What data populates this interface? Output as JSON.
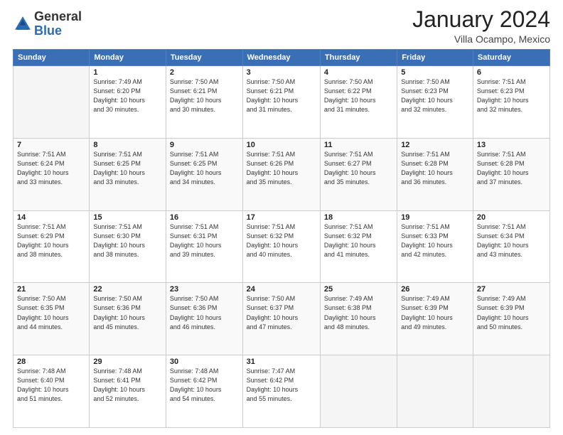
{
  "logo": {
    "general": "General",
    "blue": "Blue"
  },
  "title": "January 2024",
  "location": "Villa Ocampo, Mexico",
  "days_header": [
    "Sunday",
    "Monday",
    "Tuesday",
    "Wednesday",
    "Thursday",
    "Friday",
    "Saturday"
  ],
  "weeks": [
    [
      {
        "day": "",
        "info": ""
      },
      {
        "day": "1",
        "info": "Sunrise: 7:49 AM\nSunset: 6:20 PM\nDaylight: 10 hours\nand 30 minutes."
      },
      {
        "day": "2",
        "info": "Sunrise: 7:50 AM\nSunset: 6:21 PM\nDaylight: 10 hours\nand 30 minutes."
      },
      {
        "day": "3",
        "info": "Sunrise: 7:50 AM\nSunset: 6:21 PM\nDaylight: 10 hours\nand 31 minutes."
      },
      {
        "day": "4",
        "info": "Sunrise: 7:50 AM\nSunset: 6:22 PM\nDaylight: 10 hours\nand 31 minutes."
      },
      {
        "day": "5",
        "info": "Sunrise: 7:50 AM\nSunset: 6:23 PM\nDaylight: 10 hours\nand 32 minutes."
      },
      {
        "day": "6",
        "info": "Sunrise: 7:51 AM\nSunset: 6:23 PM\nDaylight: 10 hours\nand 32 minutes."
      }
    ],
    [
      {
        "day": "7",
        "info": "Sunrise: 7:51 AM\nSunset: 6:24 PM\nDaylight: 10 hours\nand 33 minutes."
      },
      {
        "day": "8",
        "info": "Sunrise: 7:51 AM\nSunset: 6:25 PM\nDaylight: 10 hours\nand 33 minutes."
      },
      {
        "day": "9",
        "info": "Sunrise: 7:51 AM\nSunset: 6:25 PM\nDaylight: 10 hours\nand 34 minutes."
      },
      {
        "day": "10",
        "info": "Sunrise: 7:51 AM\nSunset: 6:26 PM\nDaylight: 10 hours\nand 35 minutes."
      },
      {
        "day": "11",
        "info": "Sunrise: 7:51 AM\nSunset: 6:27 PM\nDaylight: 10 hours\nand 35 minutes."
      },
      {
        "day": "12",
        "info": "Sunrise: 7:51 AM\nSunset: 6:28 PM\nDaylight: 10 hours\nand 36 minutes."
      },
      {
        "day": "13",
        "info": "Sunrise: 7:51 AM\nSunset: 6:28 PM\nDaylight: 10 hours\nand 37 minutes."
      }
    ],
    [
      {
        "day": "14",
        "info": "Sunrise: 7:51 AM\nSunset: 6:29 PM\nDaylight: 10 hours\nand 38 minutes."
      },
      {
        "day": "15",
        "info": "Sunrise: 7:51 AM\nSunset: 6:30 PM\nDaylight: 10 hours\nand 38 minutes."
      },
      {
        "day": "16",
        "info": "Sunrise: 7:51 AM\nSunset: 6:31 PM\nDaylight: 10 hours\nand 39 minutes."
      },
      {
        "day": "17",
        "info": "Sunrise: 7:51 AM\nSunset: 6:32 PM\nDaylight: 10 hours\nand 40 minutes."
      },
      {
        "day": "18",
        "info": "Sunrise: 7:51 AM\nSunset: 6:32 PM\nDaylight: 10 hours\nand 41 minutes."
      },
      {
        "day": "19",
        "info": "Sunrise: 7:51 AM\nSunset: 6:33 PM\nDaylight: 10 hours\nand 42 minutes."
      },
      {
        "day": "20",
        "info": "Sunrise: 7:51 AM\nSunset: 6:34 PM\nDaylight: 10 hours\nand 43 minutes."
      }
    ],
    [
      {
        "day": "21",
        "info": "Sunrise: 7:50 AM\nSunset: 6:35 PM\nDaylight: 10 hours\nand 44 minutes."
      },
      {
        "day": "22",
        "info": "Sunrise: 7:50 AM\nSunset: 6:36 PM\nDaylight: 10 hours\nand 45 minutes."
      },
      {
        "day": "23",
        "info": "Sunrise: 7:50 AM\nSunset: 6:36 PM\nDaylight: 10 hours\nand 46 minutes."
      },
      {
        "day": "24",
        "info": "Sunrise: 7:50 AM\nSunset: 6:37 PM\nDaylight: 10 hours\nand 47 minutes."
      },
      {
        "day": "25",
        "info": "Sunrise: 7:49 AM\nSunset: 6:38 PM\nDaylight: 10 hours\nand 48 minutes."
      },
      {
        "day": "26",
        "info": "Sunrise: 7:49 AM\nSunset: 6:39 PM\nDaylight: 10 hours\nand 49 minutes."
      },
      {
        "day": "27",
        "info": "Sunrise: 7:49 AM\nSunset: 6:39 PM\nDaylight: 10 hours\nand 50 minutes."
      }
    ],
    [
      {
        "day": "28",
        "info": "Sunrise: 7:48 AM\nSunset: 6:40 PM\nDaylight: 10 hours\nand 51 minutes."
      },
      {
        "day": "29",
        "info": "Sunrise: 7:48 AM\nSunset: 6:41 PM\nDaylight: 10 hours\nand 52 minutes."
      },
      {
        "day": "30",
        "info": "Sunrise: 7:48 AM\nSunset: 6:42 PM\nDaylight: 10 hours\nand 54 minutes."
      },
      {
        "day": "31",
        "info": "Sunrise: 7:47 AM\nSunset: 6:42 PM\nDaylight: 10 hours\nand 55 minutes."
      },
      {
        "day": "",
        "info": ""
      },
      {
        "day": "",
        "info": ""
      },
      {
        "day": "",
        "info": ""
      }
    ]
  ]
}
